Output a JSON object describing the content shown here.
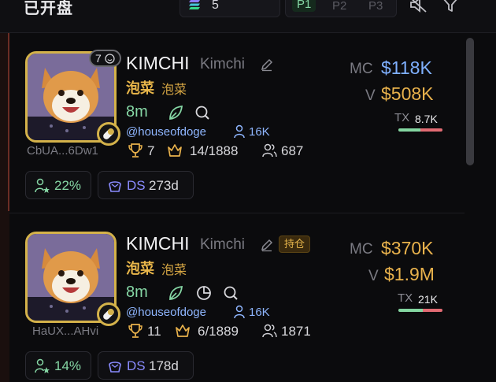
{
  "topbar": {
    "title": "已开盘",
    "quantity": "5",
    "presets": [
      "P1",
      "P2",
      "P3"
    ],
    "active_preset": "P1"
  },
  "colors": {
    "accent_green": "#86d7a5",
    "gold": "#e9b24c",
    "blue": "#7fb0ff",
    "ds_purple": "#8a8bff"
  },
  "tokens": [
    {
      "name": "KIMCHI",
      "ticker": "Kimchi",
      "tag": "",
      "cn_name": "泡菜",
      "cn_name2": "泡菜",
      "age": "8m",
      "handle": "@houseofdoge",
      "followers": "16K",
      "trophies": "7",
      "rank": "14/1888",
      "holders": "687",
      "address": "CbUA...6Dw1",
      "badge_count": "7",
      "dev_pct": "22%",
      "ds_label": "DS",
      "ds_days": "273d",
      "mc_label": "MC",
      "mc": "$118K",
      "mc_color": "#7fb0ff",
      "v_label": "V",
      "volume": "$508K",
      "tx_label": "TX",
      "tx": "8.7K",
      "tx_buy_fraction": 0.5,
      "icons": [
        "leaf-icon",
        "search-icon"
      ]
    },
    {
      "name": "KIMCHI",
      "ticker": "Kimchi",
      "tag": "持仓",
      "cn_name": "泡菜",
      "cn_name2": "泡菜",
      "age": "8m",
      "handle": "@houseofdoge",
      "followers": "16K",
      "trophies": "11",
      "rank": "6/1889",
      "holders": "1871",
      "address": "HaUX...AHvi",
      "dev_pct": "14%",
      "ds_label": "DS",
      "ds_days": "178d",
      "mc_label": "MC",
      "mc": "$370K",
      "mc_color": "#e9b24c",
      "v_label": "V",
      "volume": "$1.9M",
      "tx_label": "TX",
      "tx": "21K",
      "tx_buy_fraction": 0.55,
      "icons": [
        "leaf-icon",
        "pie-chart-icon",
        "search-icon"
      ]
    }
  ]
}
